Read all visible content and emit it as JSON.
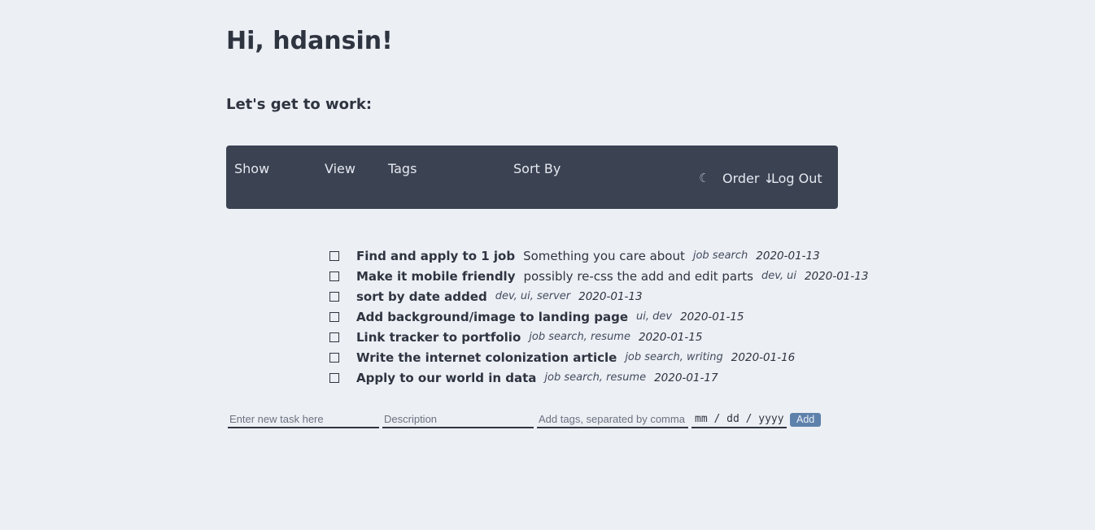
{
  "header": {
    "greeting": "Hi, hdansin!",
    "subtitle": "Let's get to work:"
  },
  "navbar": {
    "show_label": "Show",
    "view_label": "View",
    "tags_label": "Tags",
    "sort_label": "Sort By",
    "theme_icon": "moon-icon",
    "theme_glyph": "☾",
    "order_label": "Order ↓",
    "logout_label": "Log Out"
  },
  "tasks": [
    {
      "title": "Find and apply to 1 job",
      "description": "Something you care about",
      "tags": "job search",
      "date": "2020-01-13"
    },
    {
      "title": "Make it mobile friendly",
      "description": "possibly re-css the add and edit parts",
      "tags": "dev, ui",
      "date": "2020-01-13"
    },
    {
      "title": "sort by date added",
      "description": "",
      "tags": "dev, ui, server",
      "date": "2020-01-13"
    },
    {
      "title": "Add background/image to landing page",
      "description": "",
      "tags": "ui, dev",
      "date": "2020-01-15"
    },
    {
      "title": "Link tracker to portfolio",
      "description": "",
      "tags": "job search, resume",
      "date": "2020-01-15"
    },
    {
      "title": "Write the internet colonization article",
      "description": "",
      "tags": "job search, writing",
      "date": "2020-01-16"
    },
    {
      "title": "Apply to our world in data",
      "description": "",
      "tags": "job search, resume",
      "date": "2020-01-17"
    }
  ],
  "add_form": {
    "task_placeholder": "Enter new task here",
    "description_placeholder": "Description",
    "tags_placeholder": "Add tags, separated by comma",
    "date_placeholder": "mm / dd / yyyy",
    "add_label": "Add"
  },
  "colors": {
    "background": "#eceff4",
    "navbar": "#3b4252",
    "accent": "#5e81ac",
    "text": "#2e3440"
  }
}
